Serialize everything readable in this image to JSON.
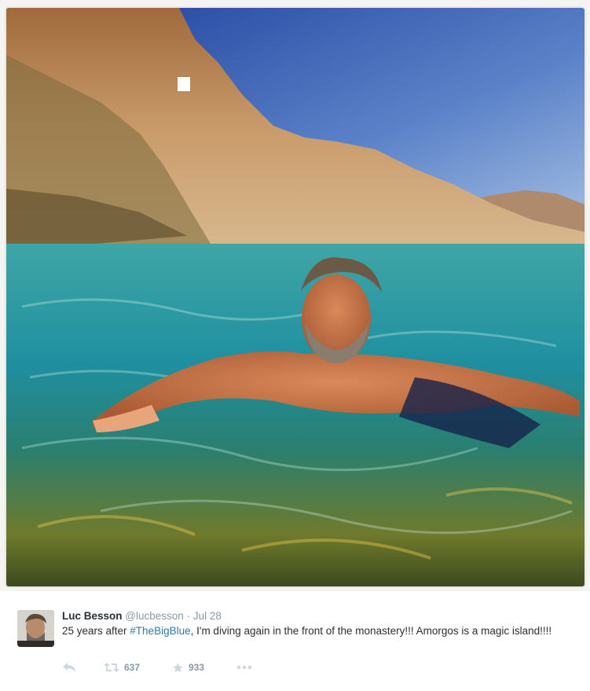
{
  "photo": {
    "icon": "beach-swimmer-photo"
  },
  "tweet": {
    "display_name": "Luc Besson",
    "handle": "@lucbesson",
    "separator": "·",
    "date": "Jul 28",
    "text_before": "25 years after ",
    "hashtag": "#TheBigBlue",
    "text_after": ", I'm diving again in the front of the monastery!!! Amorgos is a magic island!!!!",
    "colors": {
      "hashtag": "#2b7bb9",
      "meta": "#8899a6",
      "text": "#292f33"
    }
  },
  "actions": {
    "reply_icon": "reply-icon",
    "retweet_icon": "retweet-icon",
    "retweet_count": "637",
    "favorite_icon": "star-icon",
    "favorite_count": "933",
    "more_icon": "more-icon"
  }
}
